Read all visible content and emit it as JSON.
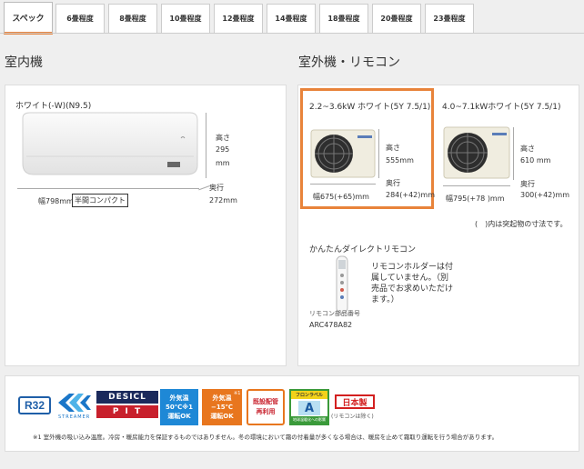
{
  "tabs": [
    {
      "label": "スペック",
      "active": true
    },
    {
      "label": "6畳程度"
    },
    {
      "label": "8畳程度"
    },
    {
      "label": "10畳程度"
    },
    {
      "label": "12畳程度"
    },
    {
      "label": "14畳程度"
    },
    {
      "label": "18畳程度"
    },
    {
      "label": "20畳程度"
    },
    {
      "label": "23畳程度"
    }
  ],
  "indoor": {
    "heading": "室内機",
    "color_label": "ホワイト(-W)(N9.5)",
    "height_label": "高さ",
    "height_value": "295",
    "height_unit": "mm",
    "depth_label": "奥行",
    "depth_value": "272mm",
    "width_value": "幅798mm",
    "compact_badge": "半間コンパクト"
  },
  "outdoor": {
    "heading": "室外機・リモコン",
    "unit1": {
      "title": "2.2~3.6kW ホワイト(5Y 7.5/1)",
      "height_label": "高さ",
      "height_value": "555mm",
      "depth_label": "奥行",
      "depth_value": "284(+42)mm",
      "width_value": "幅675(+65)mm"
    },
    "unit2": {
      "title": "4.0~7.1kWホワイト(5Y 7.5/1)",
      "height_label": "高さ",
      "height_value": "610 mm",
      "depth_label": "奥行",
      "depth_value": "300(+42)mm",
      "width_value": "幅795(+78 )mm"
    },
    "note": "(　)内は突起物の寸法です。",
    "remote_title": "かんたんダイレクトリモコン",
    "remote_desc": "リモコンホルダーは付属していません。（別売品でお求めいただけます。）",
    "remote_part_label": "リモコン部品番号",
    "remote_part_no": "ARC478A82"
  },
  "features": {
    "r32": "R32",
    "streamer": "STREAMER",
    "desicl_top": "DESICL",
    "desicl_bottom": "P I T",
    "outdoor50_l1": "外気温",
    "outdoor50_l2": "50℃※1",
    "outdoor50_l3": "運転OK",
    "outdoor15_l1": "外気温",
    "outdoor15_l2": "−15℃",
    "outdoor15_l3": "運転OK",
    "outdoor15_note": "※1",
    "reuse_l1": "既設配管",
    "reuse_l2": "再利用",
    "freon_top": "フロンラベル",
    "freon_grade": "A",
    "freon_bottom": "地球温暖化への影響",
    "japan_l1": "日本製",
    "japan_l2": "(リモコンは除く)",
    "footnote": "※1 室外機の吸い込み温度。冷房・暖房能力を保証するものではありません。冬の環境において霜の付着量が多くなる場合は、暖房を止めて霜取り運転を行う場合があります。"
  },
  "colors": {
    "accent": "#e8833a",
    "r32_blue": "#1f5fa8",
    "streamer_blue": "#1a76c8",
    "blue_badge": "#1e88d6",
    "orange_badge": "#e8761e",
    "japan_red": "#d32020"
  }
}
